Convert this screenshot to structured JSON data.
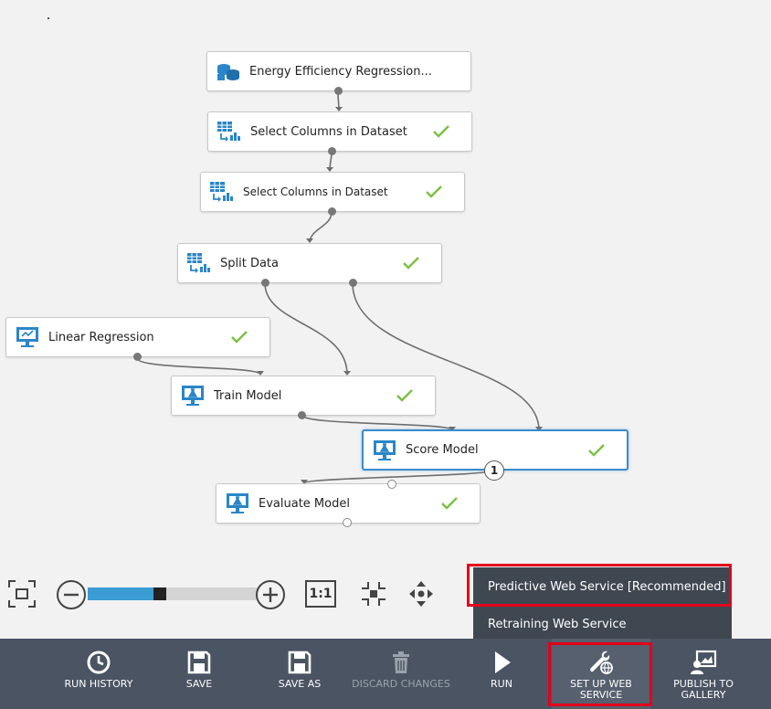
{
  "nodes": [
    {
      "id": "dataset",
      "label": "Energy Efficiency Regression...",
      "icon": "dataset-icon",
      "status": "none"
    },
    {
      "id": "select1",
      "label": "Select Columns in Dataset",
      "icon": "table-transform-icon",
      "status": "complete"
    },
    {
      "id": "select2",
      "label": "Select Columns in Dataset",
      "icon": "table-transform-icon",
      "status": "complete"
    },
    {
      "id": "split",
      "label": "Split Data",
      "icon": "table-transform-icon",
      "status": "complete"
    },
    {
      "id": "linreg",
      "label": "Linear Regression",
      "icon": "monitor-icon",
      "status": "complete"
    },
    {
      "id": "train",
      "label": "Train Model",
      "icon": "flask-monitor-icon",
      "status": "complete"
    },
    {
      "id": "score",
      "label": "Score Model",
      "icon": "flask-monitor-icon",
      "status": "complete",
      "selected": true
    },
    {
      "id": "evaluate",
      "label": "Evaluate Model",
      "icon": "flask-monitor-icon",
      "status": "complete"
    }
  ],
  "score_badge": "1",
  "zoom": {
    "level_fraction": 0.42,
    "reset_label": "1:1",
    "icons": [
      "fit-screen-icon",
      "zoom-out-icon",
      "zoom-in-icon",
      "actual-size-icon",
      "center-icon",
      "pan-icon"
    ]
  },
  "web_service_menu": {
    "items": [
      {
        "label": "Predictive Web Service [Recommended]",
        "highlighted": true
      },
      {
        "label": "Retraining Web Service",
        "highlighted": false
      }
    ]
  },
  "toolbar": {
    "run_history": "RUN HISTORY",
    "save": "SAVE",
    "save_as": "SAVE AS",
    "discard": "DISCARD CHANGES",
    "run": "RUN",
    "setup_line1": "SET UP WEB",
    "setup_line2": "SERVICE",
    "publish_line1": "PUBLISH TO",
    "publish_line2": "GALLERY"
  },
  "colors": {
    "accent": "#3b9bd3",
    "check": "#7ac143",
    "toolbar_bg": "#4a5462",
    "menu_bg": "#3f4751",
    "highlight": "#e3001b"
  }
}
